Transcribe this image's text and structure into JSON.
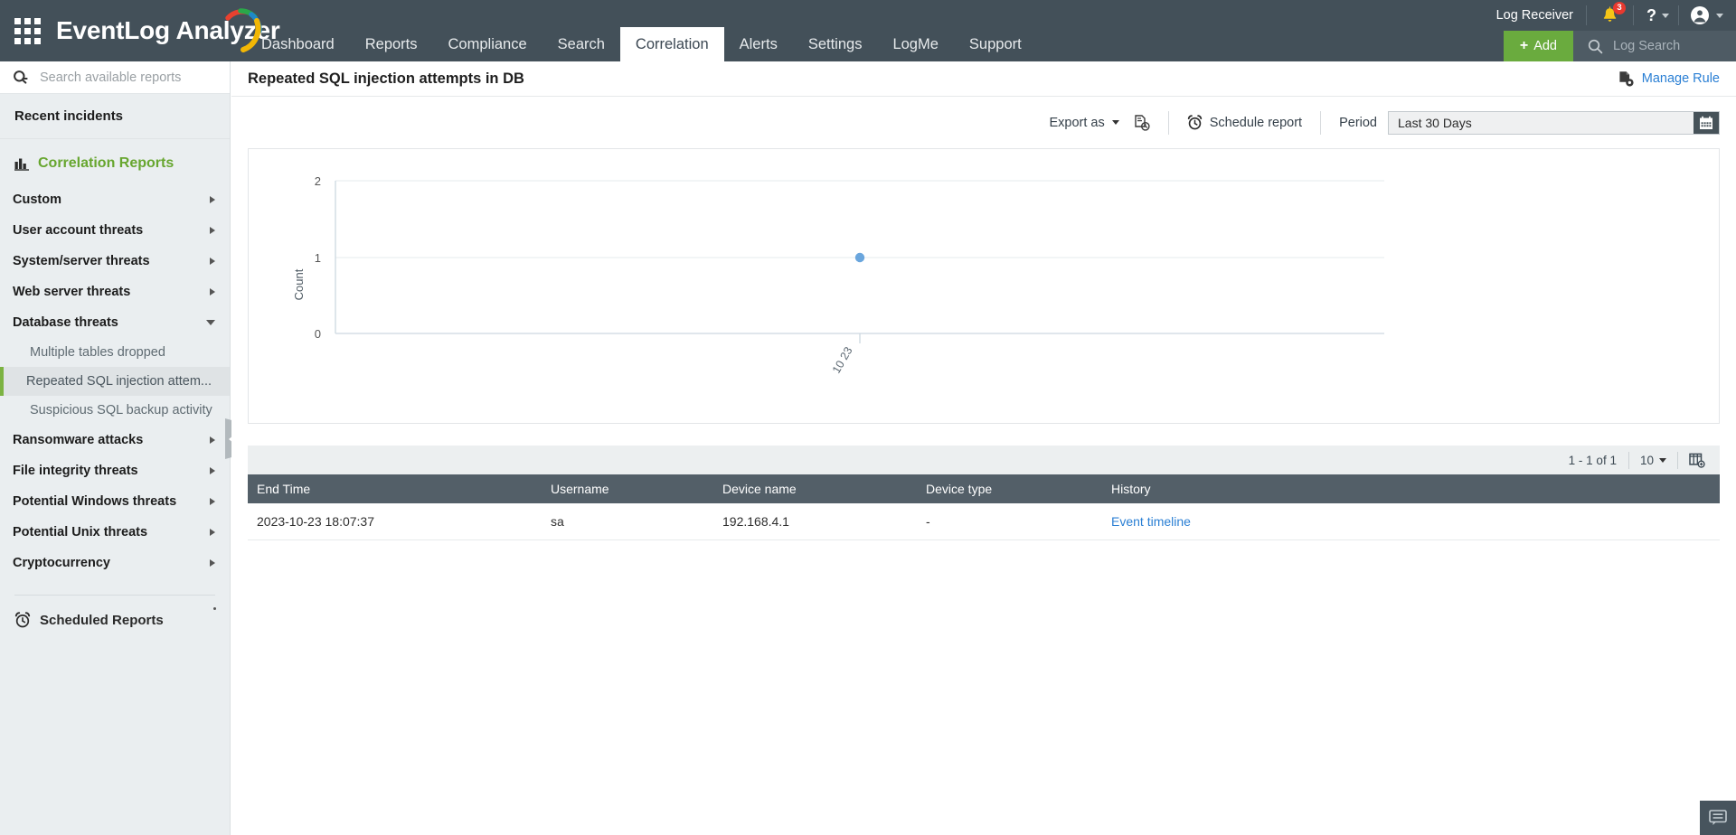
{
  "app": {
    "brand": "EventLog Analyzer",
    "waffle_icon": "apps-grid-icon"
  },
  "topbar": {
    "nav": [
      {
        "label": "Dashboard",
        "active": false
      },
      {
        "label": "Reports",
        "active": false
      },
      {
        "label": "Compliance",
        "active": false
      },
      {
        "label": "Search",
        "active": false
      },
      {
        "label": "Correlation",
        "active": true
      },
      {
        "label": "Alerts",
        "active": false
      },
      {
        "label": "Settings",
        "active": false
      },
      {
        "label": "LogMe",
        "active": false
      },
      {
        "label": "Support",
        "active": false
      }
    ],
    "log_receiver": "Log Receiver",
    "notification_count": "3",
    "help_glyph": "?",
    "add_button": "Add",
    "add_plus": "+",
    "log_search_placeholder": "Log Search"
  },
  "sidebar": {
    "search_placeholder": "Search available reports",
    "recent_incidents": "Recent incidents",
    "section_title": "Correlation Reports",
    "groups": [
      {
        "label": "Custom",
        "expanded": false
      },
      {
        "label": "User account threats",
        "expanded": false
      },
      {
        "label": "System/server threats",
        "expanded": false
      },
      {
        "label": "Web server threats",
        "expanded": false
      },
      {
        "label": "Database threats",
        "expanded": true
      },
      {
        "label": "Ransomware attacks",
        "expanded": false
      },
      {
        "label": "File integrity threats",
        "expanded": false
      },
      {
        "label": "Potential Windows threats",
        "expanded": false
      },
      {
        "label": "Potential Unix threats",
        "expanded": false
      },
      {
        "label": "Cryptocurrency",
        "expanded": false
      }
    ],
    "database_children": [
      {
        "label": "Multiple tables dropped",
        "selected": false
      },
      {
        "label": "Repeated SQL injection attem...",
        "selected": true
      },
      {
        "label": "Suspicious SQL backup activity",
        "selected": false
      }
    ],
    "scheduled_reports": "Scheduled Reports"
  },
  "page": {
    "title": "Repeated SQL injection attempts in DB",
    "manage_rule": "Manage Rule"
  },
  "toolbar": {
    "export_as": "Export as",
    "schedule_report": "Schedule report",
    "period_label": "Period",
    "period_value": "Last 30 Days"
  },
  "chart_data": {
    "type": "scatter",
    "title": "",
    "xlabel": "",
    "ylabel": "Count",
    "x_tick_labels": [
      "10 23"
    ],
    "y_ticks": [
      0,
      1,
      2
    ],
    "ylim": [
      0,
      2
    ],
    "series": [
      {
        "name": "Count",
        "color": "#6aa6dd",
        "points": [
          {
            "x": "10 23",
            "y": 1
          }
        ]
      }
    ],
    "grid": true,
    "legend": "none"
  },
  "table": {
    "pagination_text": "1 - 1 of 1",
    "page_size": "10",
    "columns": [
      "End Time",
      "Username",
      "Device name",
      "Device type",
      "History"
    ],
    "rows": [
      {
        "end_time": "2023-10-23 18:07:37",
        "username": "sa",
        "device_name": "192.168.4.1",
        "device_type": "-",
        "history": "Event timeline"
      }
    ]
  },
  "colors": {
    "topbar": "#435059",
    "accent_green": "#6aab3e",
    "link_blue": "#2a7fd4",
    "section_green": "#67a62f",
    "badge_red": "#e8392f",
    "chart_point": "#6aa6dd"
  }
}
